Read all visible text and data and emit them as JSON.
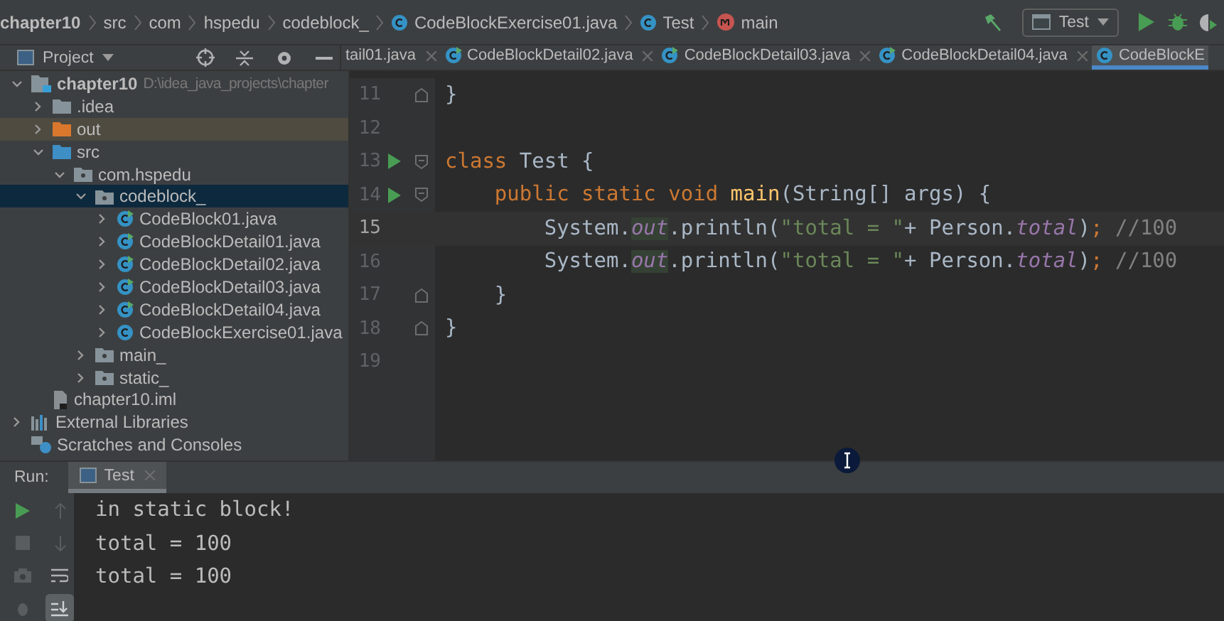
{
  "breadcrumbs": [
    {
      "label": "chapter10",
      "kind": "project"
    },
    {
      "label": "src",
      "kind": "folder"
    },
    {
      "label": "com",
      "kind": "folder"
    },
    {
      "label": "hspedu",
      "kind": "folder"
    },
    {
      "label": "codeblock_",
      "kind": "folder"
    },
    {
      "label": "CodeBlockExercise01.java",
      "kind": "class"
    },
    {
      "label": "Test",
      "kind": "class"
    },
    {
      "label": "main",
      "kind": "method"
    }
  ],
  "run_config": {
    "label": "Test"
  },
  "project_panel": {
    "title": "Project"
  },
  "tree": [
    {
      "label": "chapter10",
      "path": "D:\\idea_java_projects\\chapter",
      "kind": "module",
      "expanded": true,
      "selected": false,
      "excluded": false,
      "children": [
        {
          "label": ".idea",
          "kind": "folder-plain",
          "expanded": false,
          "selected": false,
          "excluded": false
        },
        {
          "label": "out",
          "kind": "folder-excluded",
          "expanded": false,
          "selected": false,
          "excluded": true
        },
        {
          "label": "src",
          "kind": "folder-source",
          "expanded": true,
          "selected": false,
          "excluded": false,
          "children": [
            {
              "label": "com.hspedu",
              "kind": "package",
              "expanded": true,
              "selected": false,
              "excluded": false,
              "children": [
                {
                  "label": "codeblock_",
                  "kind": "package",
                  "expanded": true,
                  "selected": true,
                  "excluded": false,
                  "children": [
                    {
                      "label": "CodeBlock01.java",
                      "kind": "class-run",
                      "expanded": false,
                      "selected": false,
                      "excluded": false
                    },
                    {
                      "label": "CodeBlockDetail01.java",
                      "kind": "class-run",
                      "expanded": false,
                      "selected": false,
                      "excluded": false
                    },
                    {
                      "label": "CodeBlockDetail02.java",
                      "kind": "class-run",
                      "expanded": false,
                      "selected": false,
                      "excluded": false
                    },
                    {
                      "label": "CodeBlockDetail03.java",
                      "kind": "class-run",
                      "expanded": false,
                      "selected": false,
                      "excluded": false
                    },
                    {
                      "label": "CodeBlockDetail04.java",
                      "kind": "class-run",
                      "expanded": false,
                      "selected": false,
                      "excluded": false
                    },
                    {
                      "label": "CodeBlockExercise01.java",
                      "kind": "class",
                      "expanded": false,
                      "selected": false,
                      "excluded": false
                    }
                  ]
                },
                {
                  "label": "main_",
                  "kind": "package",
                  "expanded": false,
                  "selected": false,
                  "excluded": false
                },
                {
                  "label": "static_",
                  "kind": "package",
                  "expanded": false,
                  "selected": false,
                  "excluded": false
                }
              ]
            }
          ]
        },
        {
          "label": "chapter10.iml",
          "kind": "file",
          "selected": false,
          "excluded": false
        }
      ]
    },
    {
      "label": "External Libraries",
      "kind": "library",
      "expanded": false,
      "selected": false,
      "excluded": false
    },
    {
      "label": "Scratches and Consoles",
      "kind": "scratches",
      "selected": false,
      "excluded": false
    }
  ],
  "editor_tabs": [
    {
      "label": "tail01.java",
      "kind": "none",
      "selected": false,
      "closable": true
    },
    {
      "label": "CodeBlockDetail02.java",
      "kind": "class-run",
      "selected": false,
      "closable": true
    },
    {
      "label": "CodeBlockDetail03.java",
      "kind": "class-run",
      "selected": false,
      "closable": true
    },
    {
      "label": "CodeBlockDetail04.java",
      "kind": "class-run",
      "selected": false,
      "closable": true
    },
    {
      "label": "CodeBlockE",
      "kind": "class",
      "selected": true,
      "closable": false
    }
  ],
  "code_lines": [
    {
      "number": "11",
      "run": false,
      "fold_start": false,
      "fold_end": true,
      "current": false,
      "tokens": [
        {
          "kind": "plain",
          "text": "}"
        }
      ]
    },
    {
      "number": "12",
      "run": false,
      "fold_start": false,
      "fold_end": false,
      "current": false
    },
    {
      "number": "13",
      "run": true,
      "fold_start": true,
      "fold_end": false,
      "current": false,
      "tokens": [
        {
          "kind": "keyword",
          "text": "class "
        },
        {
          "kind": "plain",
          "text": "Test {"
        }
      ]
    },
    {
      "number": "14",
      "run": true,
      "fold_start": true,
      "fold_end": false,
      "current": false,
      "tokens": [
        {
          "kind": "keyword",
          "text": "    public static void "
        },
        {
          "kind": "method",
          "text": "main"
        },
        {
          "kind": "plain",
          "text": "(String[] args) {"
        }
      ]
    },
    {
      "number": "15",
      "run": false,
      "fold_start": false,
      "fold_end": false,
      "current": true,
      "tokens": [
        {
          "kind": "plain",
          "text": "        System."
        },
        {
          "kind": "field-highlight",
          "text": "out"
        },
        {
          "kind": "plain",
          "text": ".println("
        },
        {
          "kind": "string",
          "text": "\"total = \""
        },
        {
          "kind": "plain",
          "text": "+ Person."
        },
        {
          "kind": "field",
          "text": "total"
        },
        {
          "kind": "plain",
          "text": ")"
        },
        {
          "kind": "keyword",
          "text": ";"
        },
        {
          "kind": "comment",
          "text": " //100"
        }
      ]
    },
    {
      "number": "16",
      "run": false,
      "fold_start": false,
      "fold_end": false,
      "current": false,
      "tokens": [
        {
          "kind": "plain",
          "text": "        System."
        },
        {
          "kind": "field-highlight",
          "text": "out"
        },
        {
          "kind": "plain",
          "text": ".println("
        },
        {
          "kind": "string",
          "text": "\"total = \""
        },
        {
          "kind": "plain",
          "text": "+ Person."
        },
        {
          "kind": "field",
          "text": "total"
        },
        {
          "kind": "plain",
          "text": ")"
        },
        {
          "kind": "keyword",
          "text": ";"
        },
        {
          "kind": "comment",
          "text": " //100"
        }
      ]
    },
    {
      "number": "17",
      "run": false,
      "fold_start": false,
      "fold_end": true,
      "current": false,
      "tokens": [
        {
          "kind": "plain",
          "text": "    }"
        }
      ]
    },
    {
      "number": "18",
      "run": false,
      "fold_start": false,
      "fold_end": true,
      "current": false,
      "tokens": [
        {
          "kind": "plain",
          "text": "}"
        }
      ]
    },
    {
      "number": "19",
      "run": false,
      "fold_start": false,
      "fold_end": false,
      "current": false
    }
  ],
  "run_panel": {
    "label": "Run:",
    "tabs": [
      {
        "label": "Test",
        "selected": true
      }
    ],
    "output": [
      "in static block!",
      "total = 100",
      "total = 100"
    ]
  }
}
